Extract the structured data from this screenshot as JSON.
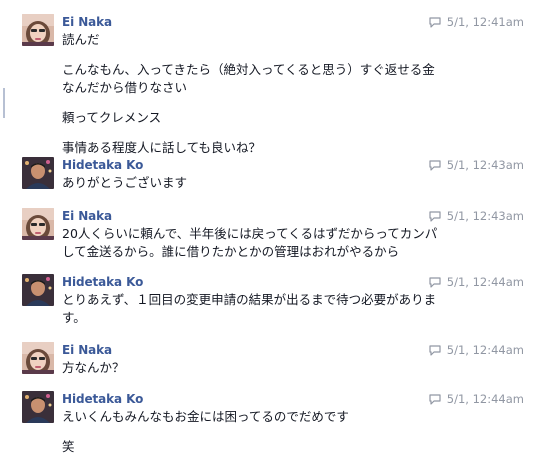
{
  "messages": [
    {
      "sender": "Ei Naka",
      "avatar": "ei-naka-avatar",
      "time": "5/1, 12:41am",
      "paragraphs": [
        [
          "読んだ"
        ],
        [
          "こんなもん、入ってきたら（絶対入ってくると思う）すぐ返せる金",
          "なんだから借りなさい"
        ],
        [
          "頼ってクレメンス"
        ],
        [
          "事情ある程度人に話しても良いね？"
        ]
      ]
    },
    {
      "sender": "Hidetaka Ko",
      "avatar": "hidetaka-ko-avatar",
      "time": "5/1, 12:43am",
      "paragraphs": [
        [
          "ありがとうございます"
        ]
      ]
    },
    {
      "sender": "Ei Naka",
      "avatar": "ei-naka-avatar",
      "time": "5/1, 12:43am",
      "paragraphs": [
        [
          "20人くらいに頼んで、半年後には戻ってくるはずだからってカンパ",
          "して金送るから。誰に借りたかとかの管理はおれがやるから"
        ]
      ]
    },
    {
      "sender": "Hidetaka Ko",
      "avatar": "hidetaka-ko-avatar",
      "time": "5/1, 12:44am",
      "paragraphs": [
        [
          "とりあえず、１回目の変更申請の結果が出るまで待つ必要がありま",
          "す。"
        ]
      ]
    },
    {
      "sender": "Ei Naka",
      "avatar": "ei-naka-avatar",
      "time": "5/1, 12:44am",
      "paragraphs": [
        [
          "方なんか？"
        ]
      ]
    },
    {
      "sender": "Hidetaka Ko",
      "avatar": "hidetaka-ko-avatar",
      "time": "5/1, 12:44am",
      "paragraphs": [
        [
          "えいくんもみんなもお金には困ってるのでだめです"
        ],
        [
          "笑"
        ]
      ]
    }
  ],
  "colors": {
    "sender": "#3b5998",
    "meta": "#9197a3",
    "text": "#141823"
  },
  "icons": {
    "timestamp": "chat-bubble-icon"
  }
}
